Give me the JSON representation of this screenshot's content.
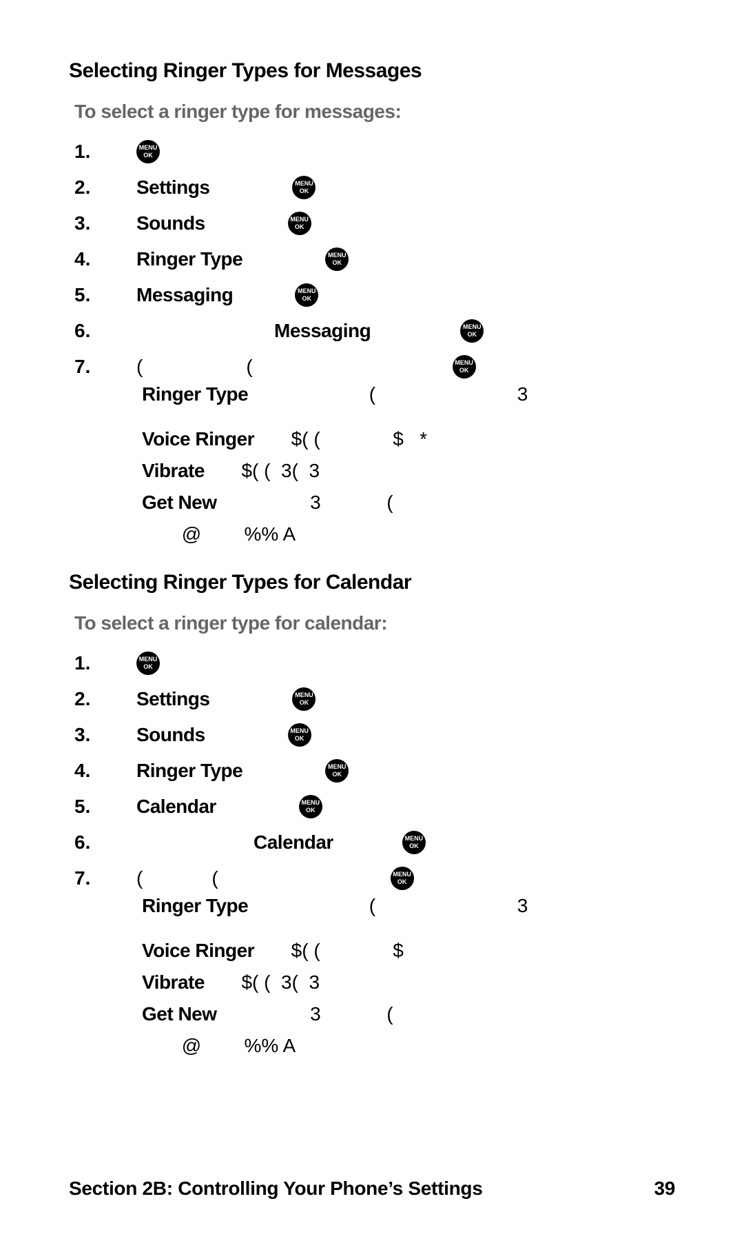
{
  "icon": {
    "menu": "MENU",
    "ok": "OK"
  },
  "sections": [
    {
      "heading": "Selecting Ringer Types for Messages",
      "subhead": "To select a ringer type for messages:",
      "steps": {
        "n1": "1.",
        "n2": "2.",
        "s2": "Settings",
        "n3": "3.",
        "s3": "Sounds",
        "n4": "4.",
        "s4": "Ringer Type",
        "n5": "5.",
        "s5": "Messaging",
        "n6": "6.",
        "s6": "Messaging",
        "n7": "7.",
        "p7a": "(",
        "p7b": "(",
        "d1a": "Ringer Type",
        "d1b": "(",
        "d1c": "3"
      },
      "bullets": {
        "b1a": "Voice Ringer",
        "b1b": "$( (",
        "b1c": "$   *",
        "b2a": "Vibrate",
        "b2b": "$( (  3(  3",
        "b3a": "Get New",
        "b3b": "3",
        "b3c": "(",
        "b4": "@        %% A"
      }
    },
    {
      "heading": "Selecting Ringer Types for Calendar",
      "subhead": "To select a ringer type for calendar:",
      "steps": {
        "n1": "1.",
        "n2": "2.",
        "s2": "Settings",
        "n3": "3.",
        "s3": "Sounds",
        "n4": "4.",
        "s4": "Ringer Type",
        "n5": "5.",
        "s5": "Calendar",
        "n6": "6.",
        "s6": "Calendar",
        "n7": "7.",
        "p7a": "(",
        "p7b": "(",
        "d1a": "Ringer Type",
        "d1b": "(",
        "d1c": "3"
      },
      "bullets": {
        "b1a": "Voice Ringer",
        "b1b": "$( (",
        "b1c": "$",
        "b2a": "Vibrate",
        "b2b": "$( (  3(  3",
        "b3a": "Get New",
        "b3b": "3",
        "b3c": "(",
        "b4": "@        %% A"
      }
    }
  ],
  "footer": {
    "left": "Section 2B: Controlling Your Phone’s Settings",
    "right": "39"
  }
}
